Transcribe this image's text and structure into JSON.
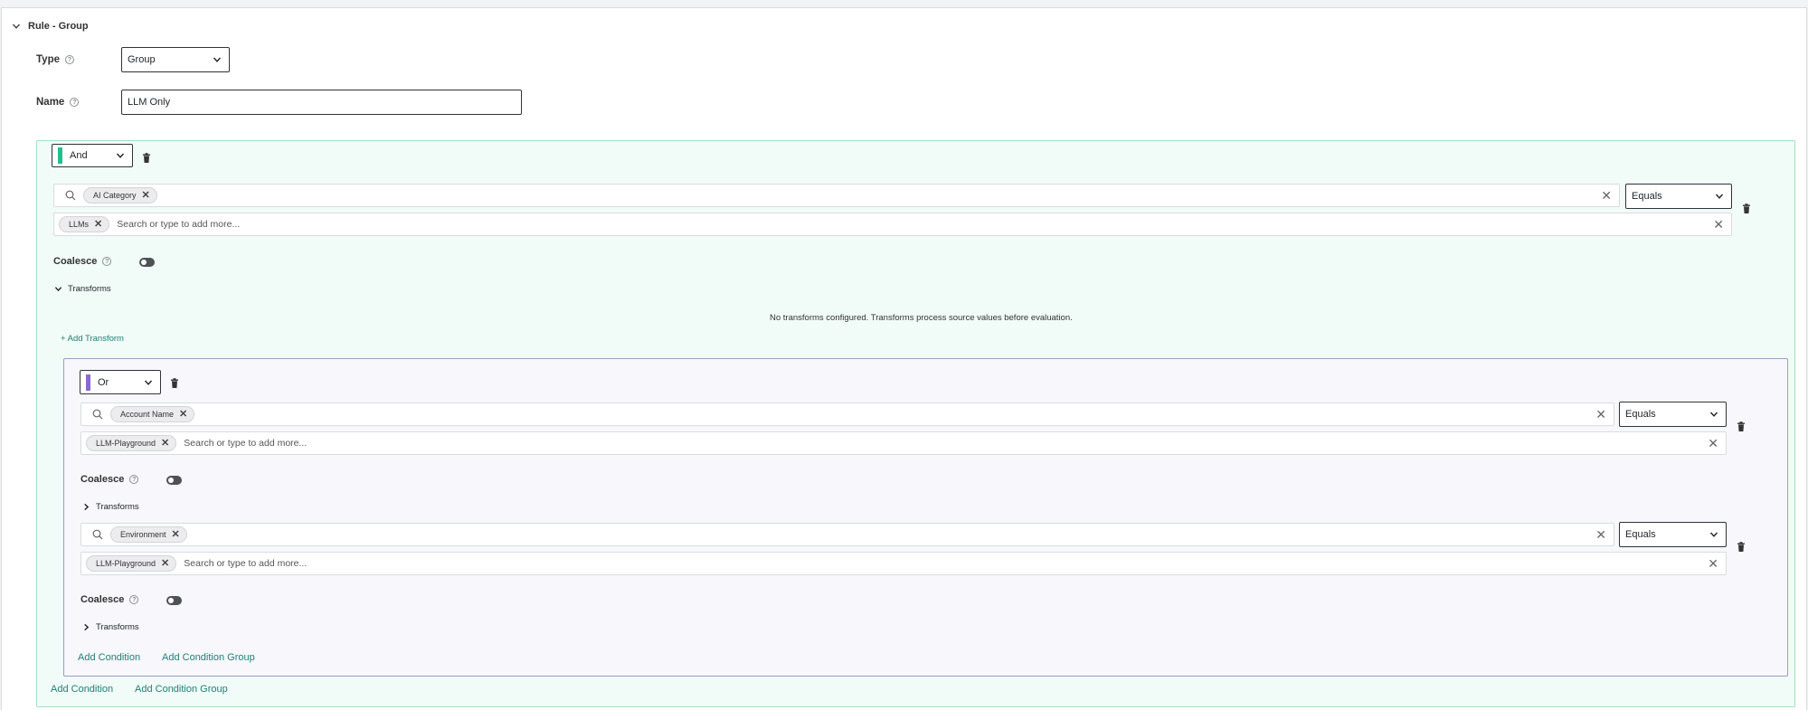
{
  "rule": {
    "title": "Rule - Group"
  },
  "type_field": {
    "label": "Type",
    "value": "Group"
  },
  "name_field": {
    "label": "Name",
    "value": "LLM Only"
  },
  "group_and": {
    "operator": "And",
    "condition1": {
      "field_chip": "AI Category",
      "operator": "Equals",
      "value_chip": "LLMs",
      "value_placeholder": "Search or type to add more...",
      "coalesce_label": "Coalesce",
      "transforms_label": "Transforms",
      "transforms_empty": "No transforms configured. Transforms process source values before evaluation.",
      "add_transform": "+ Add Transform"
    },
    "add_condition": "Add Condition",
    "add_condition_group": "Add Condition Group"
  },
  "group_or": {
    "operator": "Or",
    "condition1": {
      "field_chip": "Account Name",
      "operator": "Equals",
      "value_chip": "LLM-Playground",
      "value_placeholder": "Search or type to add more...",
      "coalesce_label": "Coalesce",
      "transforms_label": "Transforms"
    },
    "condition2": {
      "field_chip": "Environment",
      "operator": "Equals",
      "value_chip": "LLM-Playground",
      "value_placeholder": "Search or type to add more...",
      "coalesce_label": "Coalesce",
      "transforms_label": "Transforms"
    },
    "add_condition": "Add Condition",
    "add_condition_group": "Add Condition Group"
  },
  "colors": {
    "and_marker": "#1fc18a",
    "or_marker": "#8a6ad0",
    "link": "#1f7f77"
  },
  "icons": [
    "chevron-down-icon",
    "help-icon",
    "trash-icon",
    "search-icon",
    "close-icon",
    "chevron-right-icon",
    "toggle-switch"
  ]
}
